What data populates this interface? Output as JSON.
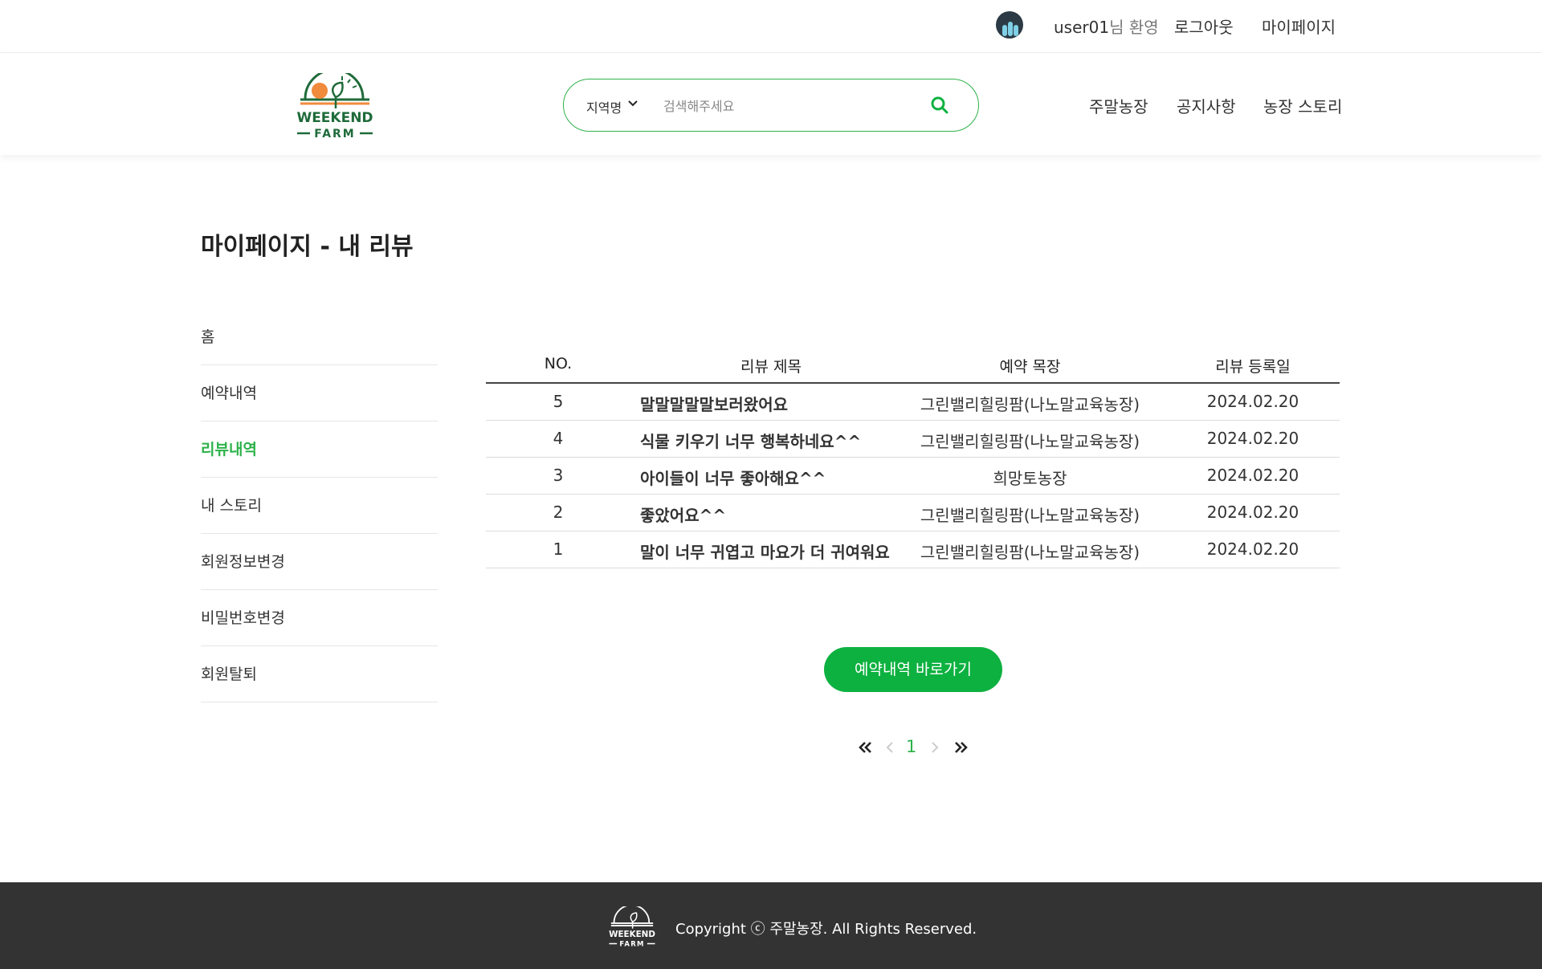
{
  "topbar": {
    "username": "user01",
    "welcome_suffix": "님 환영",
    "logout": "로그아웃",
    "mypage": "마이페이지"
  },
  "header": {
    "logo_text_top": "WEEKEND",
    "logo_text_bottom": "FARM",
    "search": {
      "region_label": "지역명",
      "placeholder": "검색해주세요",
      "search_icon": "search-icon"
    },
    "nav": [
      "주말농장",
      "공지사항",
      "농장 스토리"
    ]
  },
  "page_title": "마이페이지 - 내 리뷰",
  "side_menu": {
    "items": [
      "홈",
      "예약내역",
      "리뷰내역",
      "내 스토리",
      "회원정보변경",
      "비밀번호변경",
      "회원탈퇴"
    ],
    "active": "리뷰내역"
  },
  "table": {
    "headers": [
      "NO.",
      "리뷰 제목",
      "예약 목장",
      "리뷰 등록일"
    ],
    "rows": [
      {
        "no": "5",
        "title": "말말말말말보러왔어요",
        "farm": "그린밸리힐링팜(나노말교육농장)",
        "date": "2024.02.20"
      },
      {
        "no": "4",
        "title": "식물 키우기 너무 행복하네요^^",
        "farm": "그린밸리힐링팜(나노말교육농장)",
        "date": "2024.02.20"
      },
      {
        "no": "3",
        "title": "아이들이 너무 좋아해요^^",
        "farm": "희망토농장",
        "date": "2024.02.20"
      },
      {
        "no": "2",
        "title": "좋았어요^^",
        "farm": "그린밸리힐링팜(나노말교육농장)",
        "date": "2024.02.20"
      },
      {
        "no": "1",
        "title": "말이 너무 귀엽고 마요가 더 귀여워요",
        "farm": "그린밸리힐링팜(나노말교육농장)",
        "date": "2024.02.20"
      }
    ]
  },
  "go_button": "예약내역 바로가기",
  "pagination": {
    "current": "1",
    "icons": [
      "first-page-icon",
      "prev-page-icon",
      "next-page-icon",
      "last-page-icon"
    ]
  },
  "footer": {
    "copyright": "Copyright ⓒ 주말농장. All Rights Reserved."
  },
  "colors": {
    "accent": "#0db140",
    "accent_text": "#2db24a",
    "footer_bg": "#333333",
    "logo_sun": "#f08a3c",
    "logo_green": "#1f6b3a"
  }
}
